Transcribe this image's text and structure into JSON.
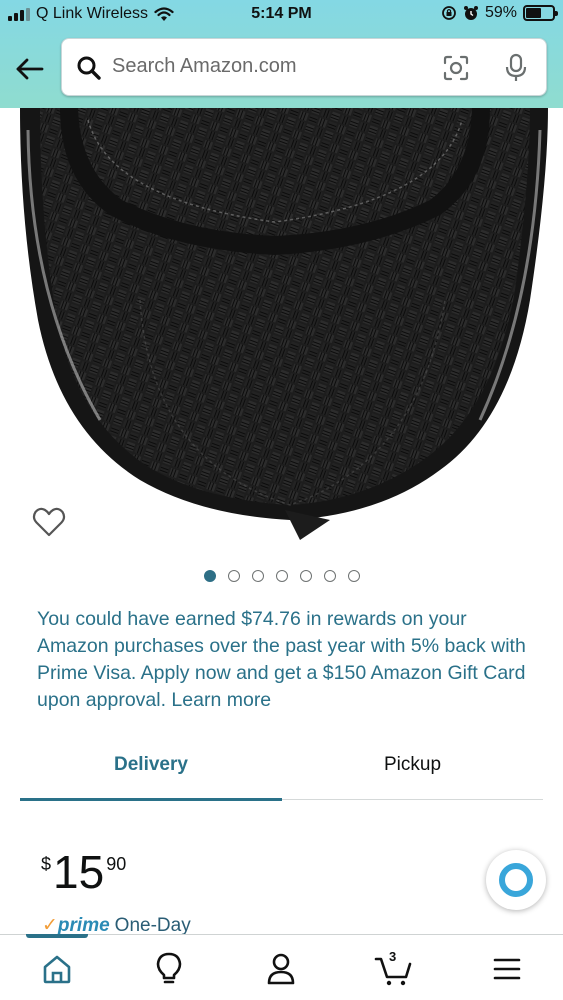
{
  "status_bar": {
    "carrier": "Q Link Wireless",
    "time": "5:14 PM",
    "battery_percent_label": "59%",
    "battery_level": 0.59,
    "icons": [
      "signal-icon",
      "wifi-icon",
      "orientation-lock-icon",
      "alarm-icon",
      "battery-icon"
    ]
  },
  "header": {
    "back_icon": "back-arrow-icon",
    "search": {
      "placeholder": "Search Amazon.com",
      "icons": [
        "search-icon",
        "camera-lens-icon",
        "microphone-icon"
      ]
    }
  },
  "product": {
    "image_icon": "product-image",
    "carousel": {
      "total": 7,
      "active_index": 0
    }
  },
  "promo": {
    "text": "You could have earned $74.76 in rewards on your Amazon purchases over the past year with 5% back with Prime Visa. Apply now and get a $150 Amazon Gift Card upon approval. Learn more"
  },
  "tabs": {
    "delivery_label": "Delivery",
    "pickup_label": "Pickup",
    "active": "Delivery"
  },
  "price": {
    "symbol": "$",
    "whole": "15",
    "fraction": "90"
  },
  "prime": {
    "check": "✓",
    "brand": "prime",
    "one_day": "One-Day"
  },
  "bottom_nav": {
    "cart_count": "3",
    "items": [
      "home-icon",
      "lightbulb-icon",
      "account-icon",
      "cart-icon",
      "menu-icon"
    ]
  },
  "colors": {
    "accent": "#2a7189",
    "header_gradient_top": "#84d8e4",
    "header_gradient_bottom": "#8fdccf",
    "alexa": "#39a6da",
    "prime_check": "#f29d38"
  }
}
